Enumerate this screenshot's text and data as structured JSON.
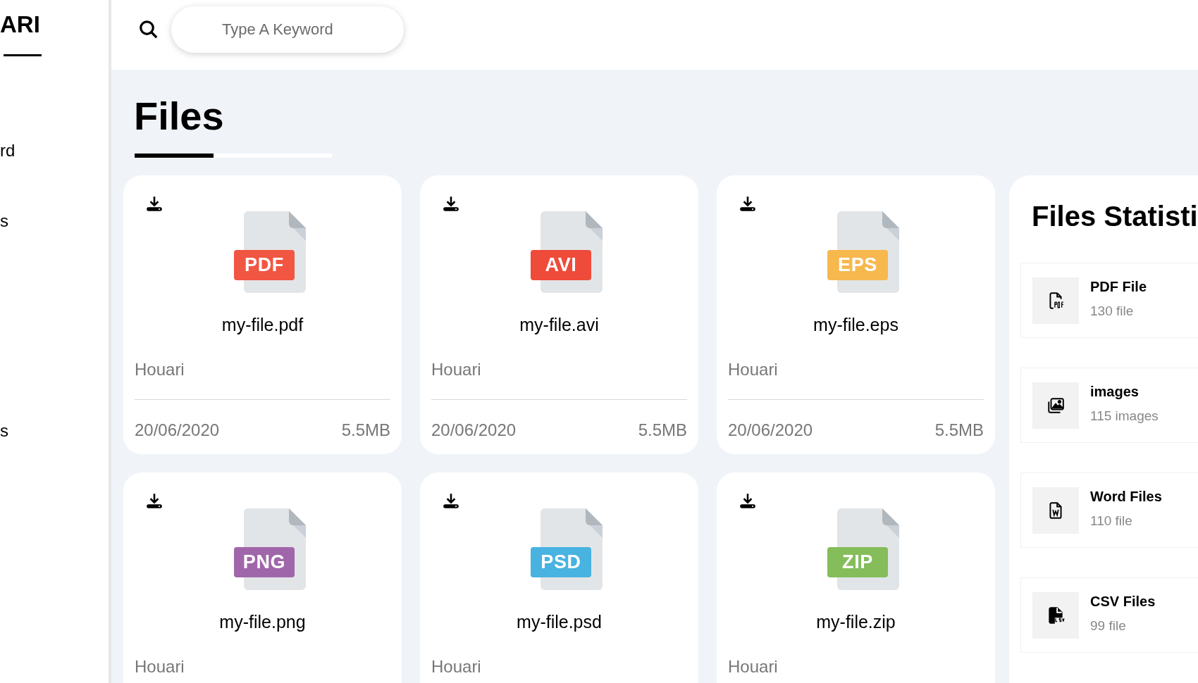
{
  "sidebar": {
    "logo": "ARI",
    "items": [
      "rd",
      "s",
      "s"
    ]
  },
  "search": {
    "placeholder": "Type A Keyword"
  },
  "page_title": "Files",
  "files": [
    {
      "badge": "PDF",
      "color": "#f15642",
      "name": "my-file.pdf",
      "owner": "Houari",
      "date": "20/06/2020",
      "size": "5.5MB"
    },
    {
      "badge": "AVI",
      "color": "#ef4b3a",
      "name": "my-file.avi",
      "owner": "Houari",
      "date": "20/06/2020",
      "size": "5.5MB"
    },
    {
      "badge": "EPS",
      "color": "#f7b84e",
      "name": "my-file.eps",
      "owner": "Houari",
      "date": "20/06/2020",
      "size": "5.5MB"
    },
    {
      "badge": "PNG",
      "color": "#a066aa",
      "name": "my-file.png",
      "owner": "Houari"
    },
    {
      "badge": "PSD",
      "color": "#48b3e0",
      "name": "my-file.psd",
      "owner": "Houari"
    },
    {
      "badge": "ZIP",
      "color": "#84bd5a",
      "name": "my-file.zip",
      "owner": "Houari"
    }
  ],
  "statistics": {
    "title": "Files Statisti",
    "items": [
      {
        "kind": "pdf",
        "label": "PDF File",
        "count": "130 file"
      },
      {
        "kind": "images",
        "label": "images",
        "count": "115 images"
      },
      {
        "kind": "word",
        "label": "Word Files",
        "count": "110 file"
      },
      {
        "kind": "csv",
        "label": "CSV Files",
        "count": "99 file"
      }
    ]
  }
}
